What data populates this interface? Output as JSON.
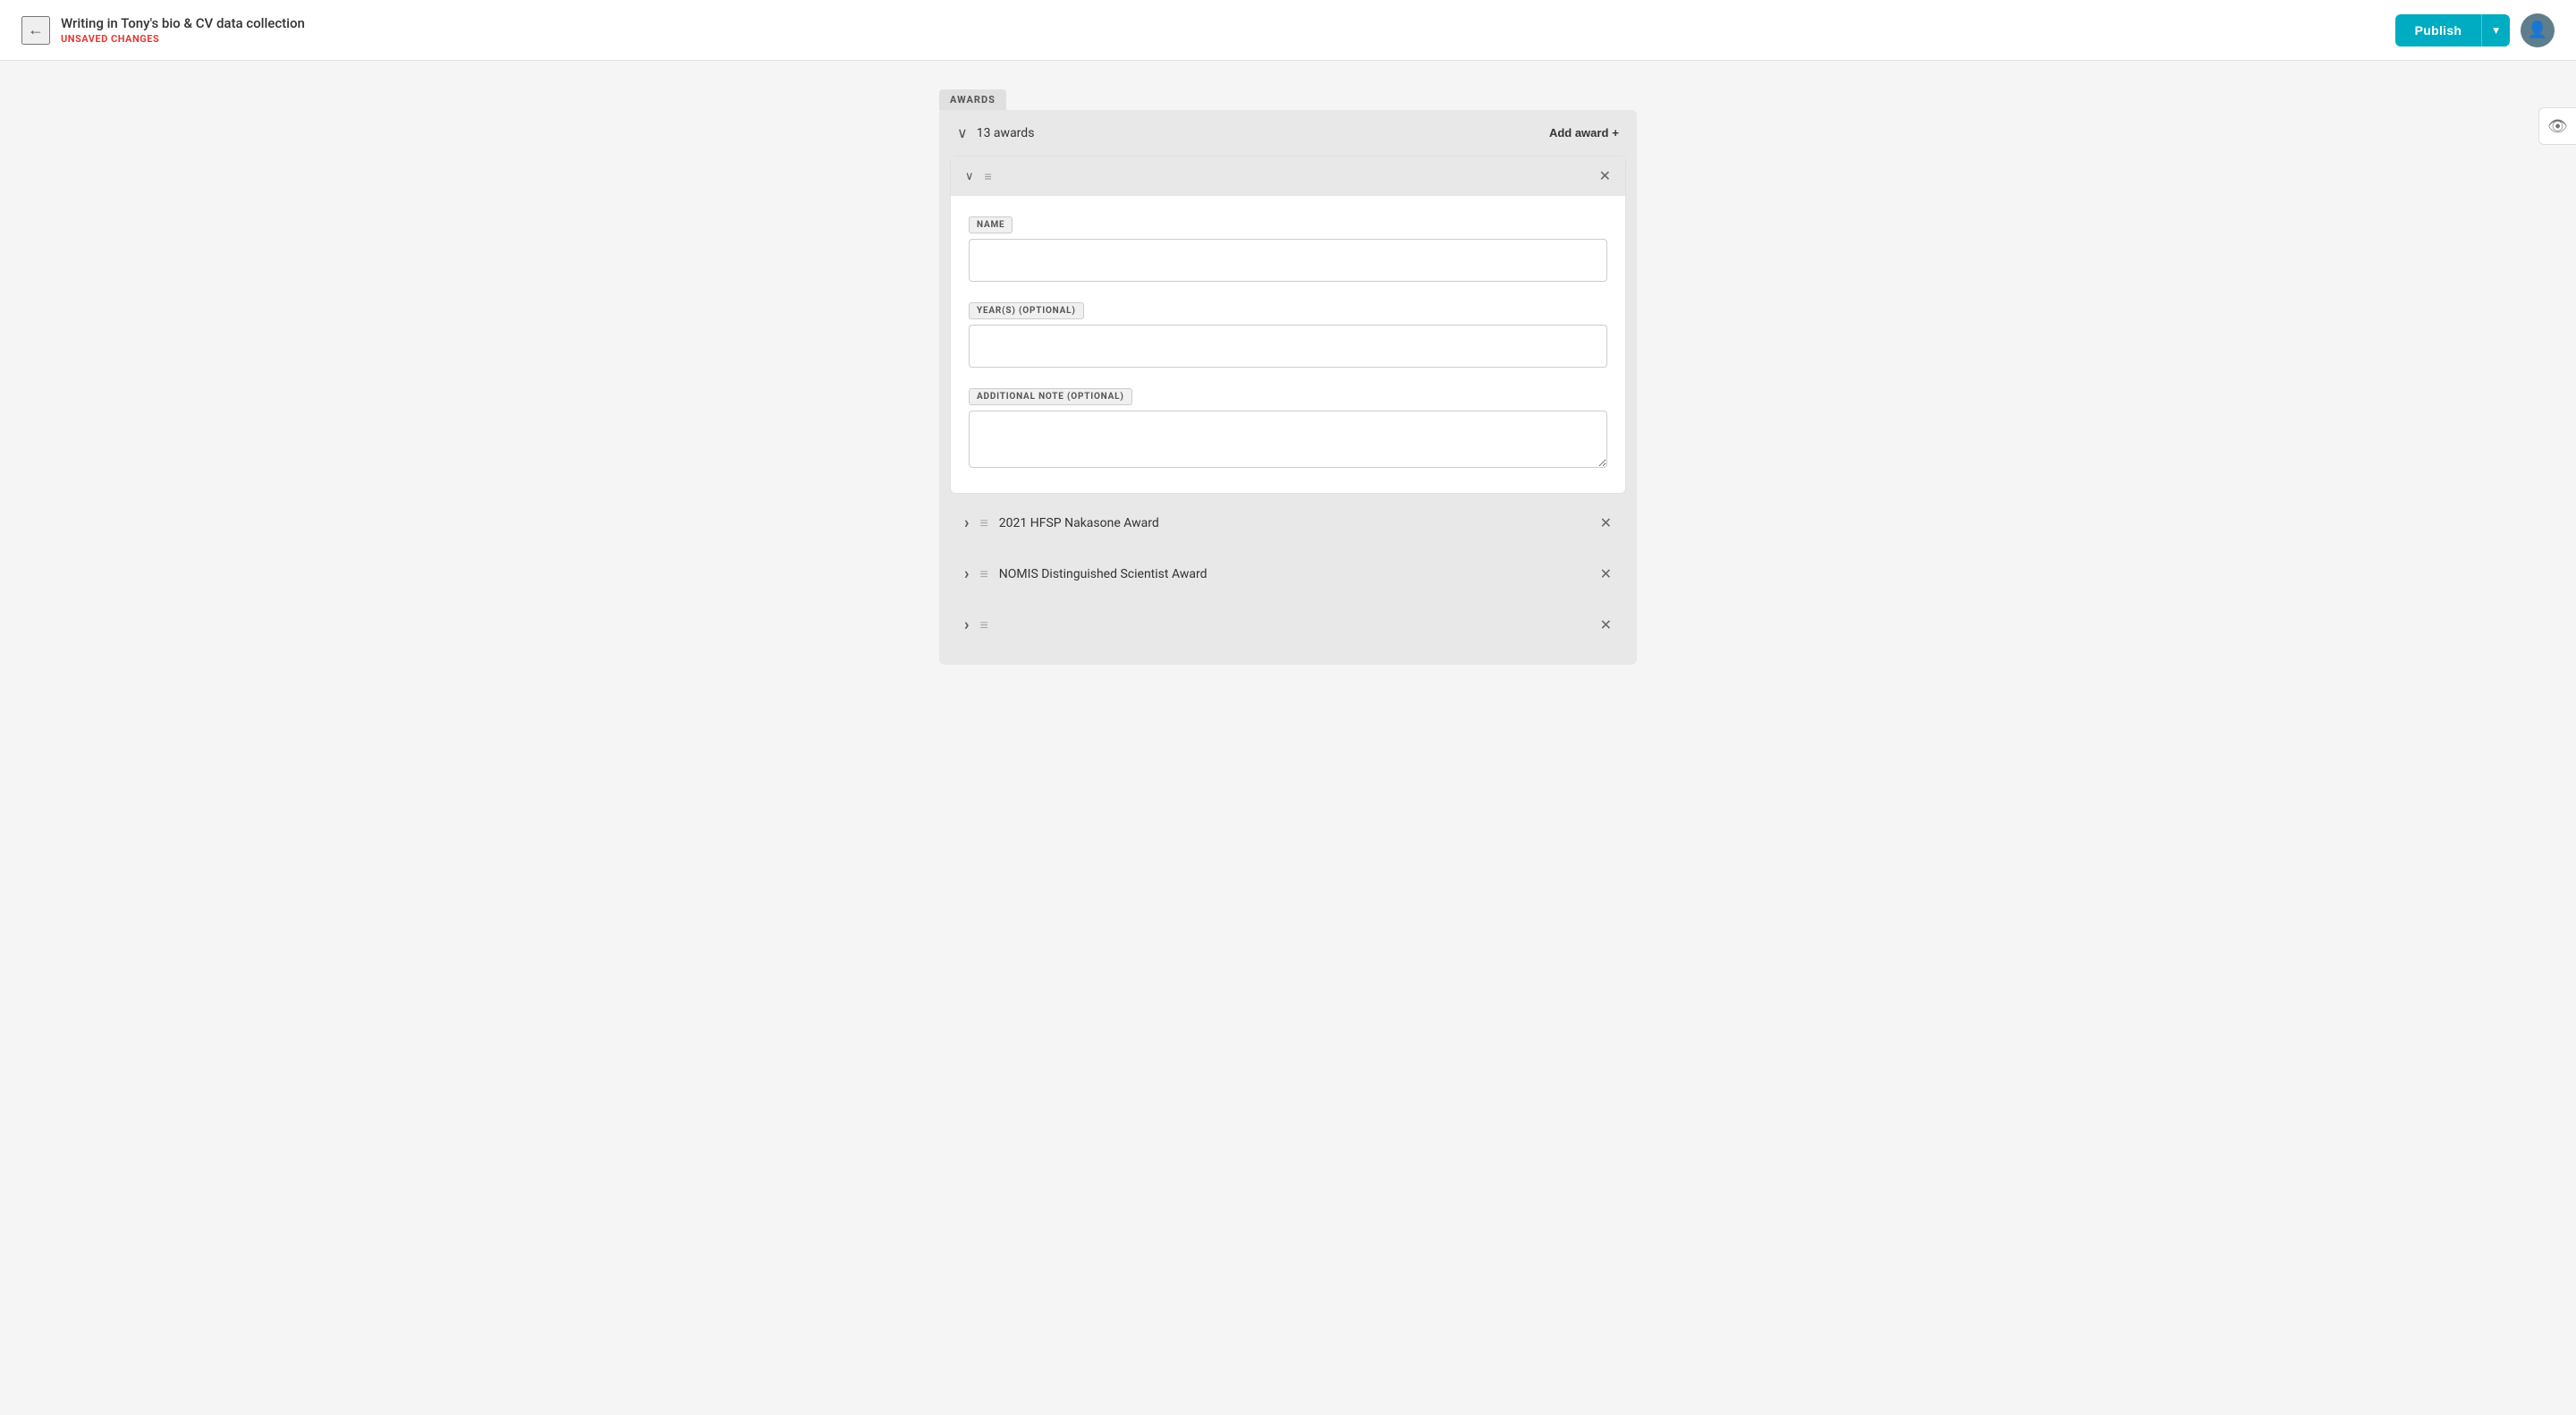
{
  "header": {
    "back_icon": "←",
    "title": "Writing in Tony's bio & CV data collection",
    "unsaved_label": "UNSAVED CHANGES",
    "publish_label": "Publish",
    "dropdown_icon": "▾"
  },
  "eye_icon": "👁",
  "awards_section": {
    "section_label": "AWARDS",
    "awards_count": "13 awards",
    "add_award_label": "Add award",
    "add_icon": "+"
  },
  "expanded_card": {
    "chevron": "∨",
    "drag": "=",
    "close": "×",
    "name_label": "NAME",
    "name_placeholder": "",
    "years_label": "YEAR(S) (OPTIONAL)",
    "years_placeholder": "",
    "note_label": "ADDITIONAL NOTE (OPTIONAL)",
    "note_placeholder": ""
  },
  "collapsed_cards": [
    {
      "id": "card-1",
      "chevron": ">",
      "drag": "=",
      "close": "×",
      "title": "2021 HFSP Nakasone Award"
    },
    {
      "id": "card-2",
      "chevron": ">",
      "drag": "=",
      "close": "×",
      "title": "NOMIS Distinguished Scientist Award"
    },
    {
      "id": "card-3",
      "chevron": ">",
      "drag": "=",
      "close": "×",
      "title": ""
    }
  ]
}
